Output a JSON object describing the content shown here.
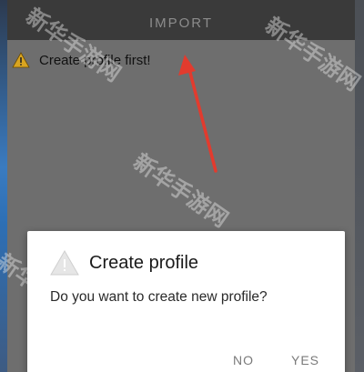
{
  "header": {
    "title": "IMPORT"
  },
  "notice": {
    "text": "Create profile first!",
    "icon": "warning-icon"
  },
  "dialog": {
    "title": "Create profile",
    "message": "Do you want to create new profile?",
    "icon": "warning-icon",
    "buttons": {
      "no_label": "NO",
      "yes_label": "YES"
    }
  },
  "watermark": {
    "text": "新华手游网"
  },
  "colors": {
    "topbar": "#3a3a3a",
    "overlay": "#6e6e6e",
    "dialog": "#ffffff",
    "arrow": "#e23b2e",
    "warning_fill": "#d9a521"
  }
}
